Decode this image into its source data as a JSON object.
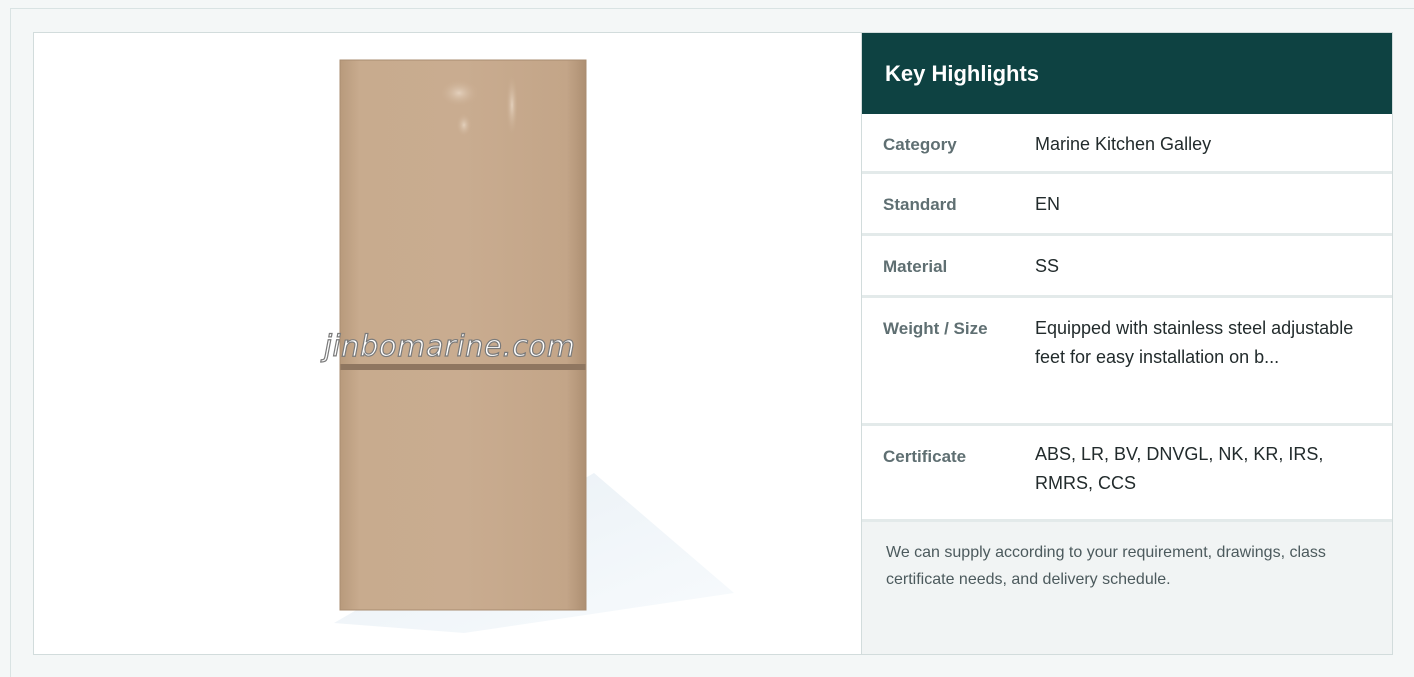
{
  "product": {
    "image_alt": "Marine refrigerator",
    "watermark": "jinbomarine.com"
  },
  "highlights": {
    "title": "Key Highlights",
    "rows": [
      {
        "label": "Category",
        "value": "Marine Kitchen Galley"
      },
      {
        "label": "Standard",
        "value": "EN"
      },
      {
        "label": "Material",
        "value": "SS"
      },
      {
        "label": "Weight / Size",
        "value": "Equipped with stainless steel adjustable feet for easy installation on b..."
      },
      {
        "label": "Certificate",
        "value": "ABS, LR, BV, DNVGL, NK, KR, IRS, RMRS, CCS"
      }
    ],
    "note": "We can supply according to your requirement, drawings, class certificate needs, and delivery schedule."
  },
  "colors": {
    "header_bg": "#0e4242",
    "fridge_body": "#c5a88b",
    "page_bg": "#f4f7f7"
  }
}
